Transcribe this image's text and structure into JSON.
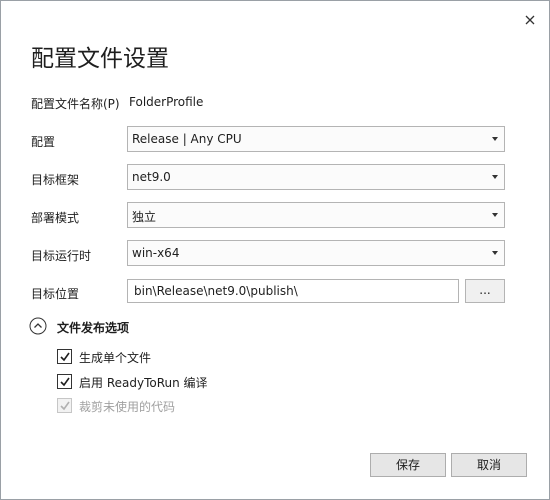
{
  "dialog": {
    "title": "配置文件设置",
    "close_icon": "close-icon"
  },
  "profile": {
    "label": "配置文件名称(P)",
    "name": "FolderProfile"
  },
  "configuration": {
    "label": "配置",
    "value": "Release | Any CPU"
  },
  "target_framework": {
    "label": "目标框架",
    "value": "net9.0"
  },
  "deployment_mode": {
    "label": "部署模式",
    "value": "独立"
  },
  "target_runtime": {
    "label": "目标运行时",
    "value": "win-x64"
  },
  "target_location": {
    "label": "目标位置",
    "value": "bin\\Release\\net9.0\\publish\\",
    "browse_label": "..."
  },
  "file_publish_options": {
    "title": "文件发布选项",
    "options": [
      {
        "label": "生成单个文件",
        "checked": true,
        "enabled": true
      },
      {
        "label": "启用 ReadyToRun 编译",
        "checked": true,
        "enabled": true
      },
      {
        "label": "裁剪未使用的代码",
        "checked": true,
        "enabled": false
      }
    ]
  },
  "footer": {
    "save_label": "保存",
    "cancel_label": "取消"
  },
  "colors": {
    "border": "#b4b4b4",
    "text": "#1e1e1e",
    "disabled_text": "#a0a0a0"
  }
}
